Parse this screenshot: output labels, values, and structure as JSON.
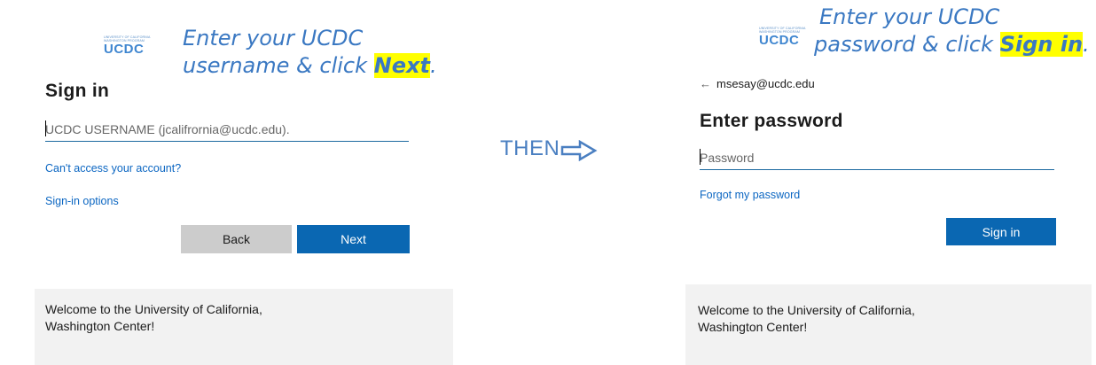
{
  "logo": {
    "org_small_line1": "UNIVERSITY OF CALIFORNIA",
    "org_small_line2": "WASHINGTON PROGRAM",
    "mark": "UCDC"
  },
  "left": {
    "instruction_line1": "Enter your UCDC",
    "instruction_line2_prefix": "username & click ",
    "instruction_highlight": "Next",
    "instruction_suffix": ".",
    "title": "Sign in",
    "username_placeholder": "UCDC USERNAME (jcalifrornia@ucdc.edu).",
    "cant_access_link": "Can't access your account?",
    "signin_options_link": "Sign-in options",
    "back_button": "Back",
    "next_button": "Next",
    "footer": "Welcome to the University of California, Washington Center!"
  },
  "middle": {
    "then_label": "THEN"
  },
  "right": {
    "instruction_line1": "Enter your UCDC",
    "instruction_line2_prefix": "password & click ",
    "instruction_highlight": "Sign in",
    "instruction_suffix": ".",
    "back_arrow": "←",
    "email": "msesay@ucdc.edu",
    "title": "Enter password",
    "password_placeholder": "Password",
    "forgot_link": "Forgot my password",
    "signin_button": "Sign in",
    "footer": "Welcome to the University of California, Washington Center!"
  },
  "colors": {
    "accent": "#0a67b2",
    "instruction": "#3a78c2",
    "highlight": "#ffff00",
    "footer_bg": "#f2f2f2"
  }
}
